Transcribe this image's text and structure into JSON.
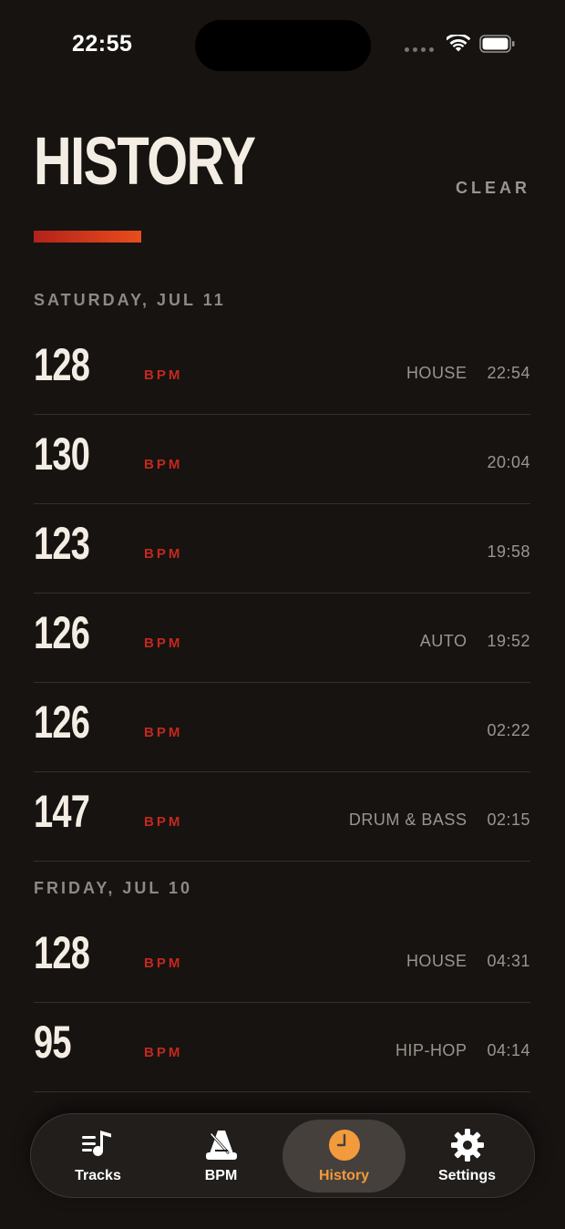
{
  "status_bar": {
    "time": "22:55"
  },
  "header": {
    "title": "HISTORY",
    "clear_label": "CLEAR"
  },
  "sections": [
    {
      "label": "SATURDAY, JUL 11",
      "rows": [
        {
          "bpm": "128",
          "unit": "BPM",
          "genre": "HOUSE",
          "time": "22:54"
        },
        {
          "bpm": "130",
          "unit": "BPM",
          "genre": "",
          "time": "20:04"
        },
        {
          "bpm": "123",
          "unit": "BPM",
          "genre": "",
          "time": "19:58"
        },
        {
          "bpm": "126",
          "unit": "BPM",
          "genre": "AUTO",
          "time": "19:52"
        },
        {
          "bpm": "126",
          "unit": "BPM",
          "genre": "",
          "time": "02:22"
        },
        {
          "bpm": "147",
          "unit": "BPM",
          "genre": "DRUM & BASS",
          "time": "02:15"
        }
      ]
    },
    {
      "label": "FRIDAY, JUL 10",
      "rows": [
        {
          "bpm": "128",
          "unit": "BPM",
          "genre": "HOUSE",
          "time": "04:31"
        },
        {
          "bpm": "95",
          "unit": "BPM",
          "genre": "HIP-HOP",
          "time": "04:14"
        }
      ]
    }
  ],
  "tab_bar": {
    "tabs": [
      {
        "label": "Tracks",
        "icon": "music-list-icon",
        "active": false
      },
      {
        "label": "BPM",
        "icon": "metronome-icon",
        "active": false
      },
      {
        "label": "History",
        "icon": "clock-icon",
        "active": true
      },
      {
        "label": "Settings",
        "icon": "gear-icon",
        "active": false
      }
    ]
  },
  "colors": {
    "accent": "#f39a3c",
    "bpm_red": "#c4281e",
    "background": "#161311"
  }
}
